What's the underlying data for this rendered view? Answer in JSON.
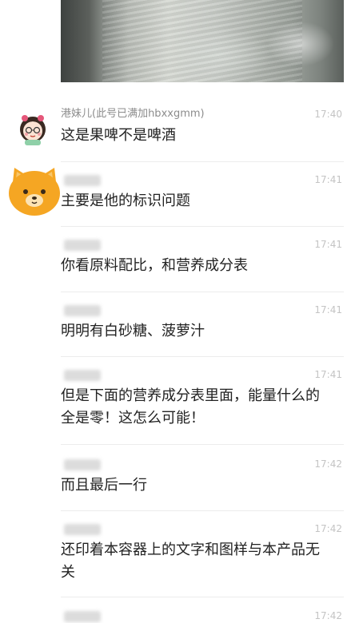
{
  "messages": [
    {
      "sender": "港妹儿(此号已满加hbxxgmm)",
      "time": "17:40",
      "text": "这是果啤不是啤酒"
    },
    {
      "sender": "",
      "time": "17:41",
      "text": "主要是他的标识问题"
    },
    {
      "sender": "",
      "time": "17:41",
      "text": "你看原料配比，和营养成分表"
    },
    {
      "sender": "",
      "time": "17:41",
      "text": "明明有白砂糖、菠萝汁"
    },
    {
      "sender": "",
      "time": "17:41",
      "text": "但是下面的营养成分表里面，能量什么的\n全是零！这怎么可能！"
    },
    {
      "sender": "",
      "time": "17:42",
      "text": "而且最后一行"
    },
    {
      "sender": "",
      "time": "17:42",
      "text": "还印着本容器上的文字和图样与本产品无\n关"
    },
    {
      "sender": "",
      "time": "17:42",
      "text": ""
    }
  ],
  "icons": {
    "avatar_1": "cartoon-girl-avatar",
    "avatar_2": "orange-bear-avatar"
  },
  "colors": {
    "background": "#ffffff",
    "text": "#222222",
    "sender": "#8c8c8c",
    "time": "#c4c4c4",
    "bear": "#f5a623"
  }
}
